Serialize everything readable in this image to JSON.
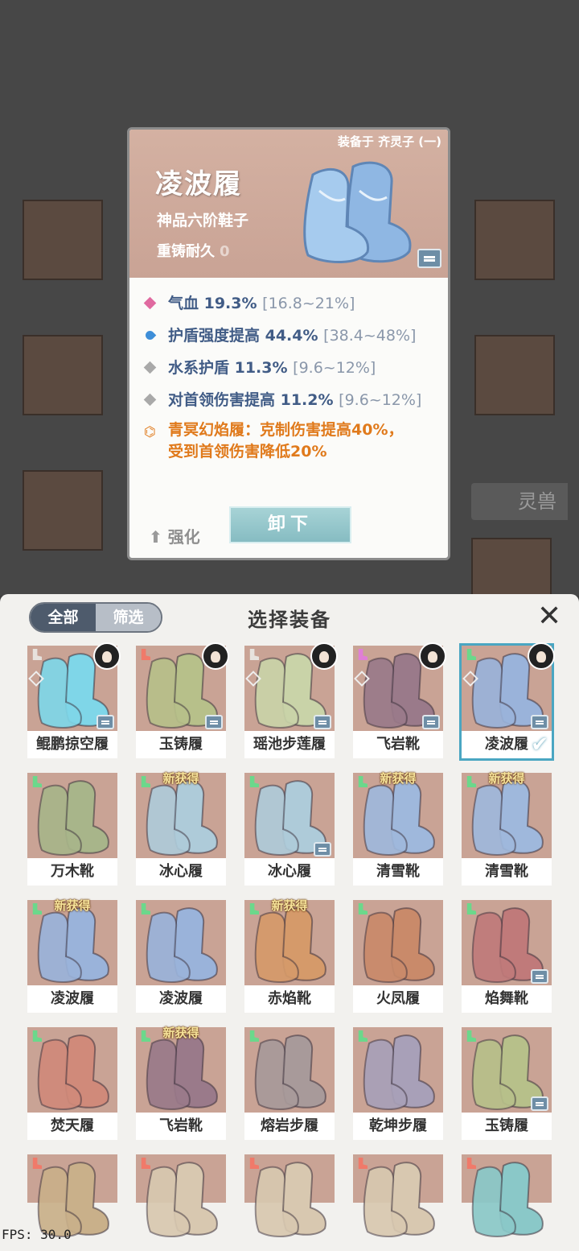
{
  "scene": {
    "tag_label": "灵兽"
  },
  "detail": {
    "equipped_on": "装备于 齐灵子 (一)",
    "name": "凌波履",
    "grade": "神品六阶鞋子",
    "durability_label": "重铸耐久",
    "durability_value": "0",
    "stats": [
      {
        "icon": "pink-diamond-icon",
        "text": "气血 19.3%",
        "range": "[16.8~21%]",
        "color": "#e06aa0"
      },
      {
        "icon": "shield-flame-icon",
        "text": "护盾强度提高 44.4%",
        "range": "[38.4~48%]",
        "color": "#3e8ed8"
      },
      {
        "icon": "gray-diamond-icon",
        "text": "水系护盾 11.3%",
        "range": "[9.6~12%]",
        "color": "#a9a9a9"
      },
      {
        "icon": "gray-diamond-icon",
        "text": "对首领伤害提高 11.2%",
        "range": "[9.6~12%]",
        "color": "#a9a9a9"
      }
    ],
    "special_line1": "青冥幻焰履：克制伤害提高40%，",
    "special_line2": "受到首领伤害降低20%",
    "enhance_label": "强化",
    "unequip_label": "卸下"
  },
  "panel": {
    "tab_all": "全部",
    "tab_filter": "筛选",
    "title": "选择装备",
    "close_icon": "close-icon",
    "new_tag": "新获得",
    "items": [
      {
        "label": "鲲鹏掠空履",
        "color": "#7fd6e8",
        "slot_color": "#e7e2dd",
        "avatar": true,
        "set": true,
        "lock": true,
        "isnew": false,
        "selected": false
      },
      {
        "label": "玉铸履",
        "color": "#b7c08a",
        "slot_color": "#f07a6a",
        "avatar": true,
        "set": false,
        "lock": true,
        "isnew": false,
        "selected": false
      },
      {
        "label": "瑶池步莲履",
        "color": "#c9d3a8",
        "slot_color": "#e7e2dd",
        "avatar": true,
        "set": true,
        "lock": true,
        "isnew": false,
        "selected": false
      },
      {
        "label": "飞岩靴",
        "color": "#9a7a8a",
        "slot_color": "#e07fd6",
        "avatar": true,
        "set": true,
        "lock": true,
        "isnew": false,
        "selected": false
      },
      {
        "label": "凌波履",
        "color": "#9ab3da",
        "slot_color": "#6bd88b",
        "avatar": true,
        "set": true,
        "lock": true,
        "isnew": false,
        "selected": true
      },
      {
        "label": "万木靴",
        "color": "#a8b58a",
        "slot_color": "#6bd88b",
        "avatar": false,
        "set": false,
        "lock": false,
        "isnew": false,
        "selected": false
      },
      {
        "label": "冰心履",
        "color": "#aecbd9",
        "slot_color": "#6bd88b",
        "avatar": false,
        "set": false,
        "lock": false,
        "isnew": true,
        "selected": false
      },
      {
        "label": "冰心履",
        "color": "#aecbd9",
        "slot_color": "#6bd88b",
        "avatar": false,
        "set": false,
        "lock": true,
        "isnew": false,
        "selected": false
      },
      {
        "label": "清雪靴",
        "color": "#9fb8dc",
        "slot_color": "#6bd88b",
        "avatar": false,
        "set": false,
        "lock": false,
        "isnew": true,
        "selected": false
      },
      {
        "label": "清雪靴",
        "color": "#9fb8dc",
        "slot_color": "#6bd88b",
        "avatar": false,
        "set": false,
        "lock": false,
        "isnew": true,
        "selected": false
      },
      {
        "label": "凌波履",
        "color": "#9ab3da",
        "slot_color": "#6bd88b",
        "avatar": false,
        "set": false,
        "lock": false,
        "isnew": true,
        "selected": false
      },
      {
        "label": "凌波履",
        "color": "#9ab3da",
        "slot_color": "#6bd88b",
        "avatar": false,
        "set": false,
        "lock": false,
        "isnew": false,
        "selected": false
      },
      {
        "label": "赤焰靴",
        "color": "#d59a6a",
        "slot_color": "#6bd88b",
        "avatar": false,
        "set": false,
        "lock": false,
        "isnew": true,
        "selected": false
      },
      {
        "label": "火凤履",
        "color": "#c98a6a",
        "slot_color": "#6bd88b",
        "avatar": false,
        "set": false,
        "lock": false,
        "isnew": false,
        "selected": false
      },
      {
        "label": "焰舞靴",
        "color": "#c07a7a",
        "slot_color": "#6bd88b",
        "avatar": false,
        "set": false,
        "lock": true,
        "isnew": false,
        "selected": false
      },
      {
        "label": "焚天履",
        "color": "#d08a7a",
        "slot_color": "#6bd88b",
        "avatar": false,
        "set": false,
        "lock": false,
        "isnew": false,
        "selected": false
      },
      {
        "label": "飞岩靴",
        "color": "#9a7a8a",
        "slot_color": "#6bd88b",
        "avatar": false,
        "set": false,
        "lock": false,
        "isnew": true,
        "selected": false
      },
      {
        "label": "熔岩步履",
        "color": "#a89a9a",
        "slot_color": "#6bd88b",
        "avatar": false,
        "set": false,
        "lock": false,
        "isnew": false,
        "selected": false
      },
      {
        "label": "乾坤步履",
        "color": "#a8a0b8",
        "slot_color": "#6bd88b",
        "avatar": false,
        "set": false,
        "lock": false,
        "isnew": false,
        "selected": false
      },
      {
        "label": "玉铸履",
        "color": "#b7c08a",
        "slot_color": "#6bd88b",
        "avatar": false,
        "set": false,
        "lock": true,
        "isnew": false,
        "selected": false
      },
      {
        "label": "",
        "color": "#c9b08a",
        "slot_color": "#f07a6a",
        "avatar": false,
        "set": false,
        "lock": false,
        "isnew": false,
        "selected": false
      },
      {
        "label": "",
        "color": "#d8c8b0",
        "slot_color": "#f07a6a",
        "avatar": false,
        "set": false,
        "lock": false,
        "isnew": false,
        "selected": false
      },
      {
        "label": "",
        "color": "#d8c8b0",
        "slot_color": "#f07a6a",
        "avatar": false,
        "set": false,
        "lock": false,
        "isnew": false,
        "selected": false
      },
      {
        "label": "",
        "color": "#d8c8b0",
        "slot_color": "#f07a6a",
        "avatar": false,
        "set": false,
        "lock": false,
        "isnew": false,
        "selected": false
      },
      {
        "label": "",
        "color": "#8ac8c8",
        "slot_color": "#f07a6a",
        "avatar": false,
        "set": false,
        "lock": false,
        "isnew": false,
        "selected": false
      }
    ]
  },
  "fps": "FPS: 30.0"
}
